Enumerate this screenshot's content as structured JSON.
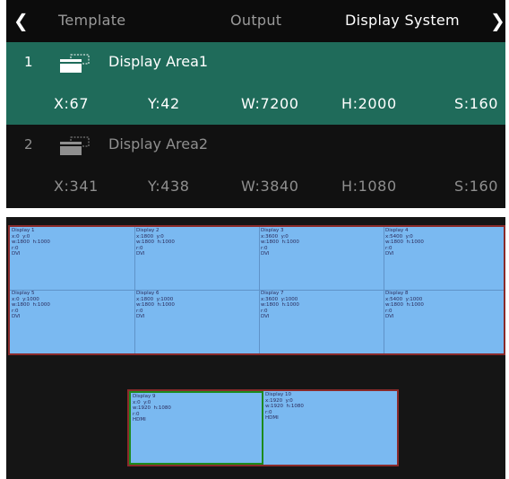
{
  "tabs": {
    "back_icon": "chevron-left-icon",
    "items": [
      "Template",
      "Output",
      "Display System"
    ],
    "active": "Display System",
    "forward_icon": "chevron-right-icon"
  },
  "areas": [
    {
      "num": "1",
      "label": "Display Area1",
      "x": "X:67",
      "y": "Y:42",
      "w": "W:7200",
      "h": "H:2000",
      "s": "S:160",
      "selected": true
    },
    {
      "num": "2",
      "label": "Display Area2",
      "x": "X:341",
      "y": "Y:438",
      "w": "W:3840",
      "h": "H:1080",
      "s": "S:160",
      "selected": false
    }
  ],
  "displays": [
    {
      "title": "Display 1",
      "pos": "x:0  y:0",
      "size": "w:1800  h:1000",
      "r": "r:0",
      "port": "DVI"
    },
    {
      "title": "Display 2",
      "pos": "x:1800  y:0",
      "size": "w:1800  h:1000",
      "r": "r:0",
      "port": "DVI"
    },
    {
      "title": "Display 3",
      "pos": "x:3600  y:0",
      "size": "w:1800  h:1000",
      "r": "r:0",
      "port": "DVI"
    },
    {
      "title": "Display 4",
      "pos": "x:5400  y:0",
      "size": "w:1800  h:1000",
      "r": "r:0",
      "port": "DVI"
    },
    {
      "title": "Display 5",
      "pos": "x:0  y:1000",
      "size": "w:1800  h:1000",
      "r": "r:0",
      "port": "DVI"
    },
    {
      "title": "Display 6",
      "pos": "x:1800  y:1000",
      "size": "w:1800  h:1000",
      "r": "r:0",
      "port": "DVI"
    },
    {
      "title": "Display 7",
      "pos": "x:3600  y:1000",
      "size": "w:1800  h:1000",
      "r": "r:0",
      "port": "DVI"
    },
    {
      "title": "Display 8",
      "pos": "x:5400  y:1000",
      "size": "w:1800  h:1000",
      "r": "r:0",
      "port": "DVI"
    },
    {
      "title": "Display 9",
      "pos": "x:0  y:0",
      "size": "w:1920  h:1080",
      "r": "r:0",
      "port": "HDMI"
    },
    {
      "title": "Display 10",
      "pos": "x:1920  y:0",
      "size": "w:1920  h:1080",
      "r": "r:0",
      "port": "HDMI"
    }
  ],
  "colors": {
    "selected_row": "#1f6b5a",
    "display_fill": "#7ab9f1",
    "area_border": "#8a2a2a",
    "selected_display_border": "#1d8a1d"
  }
}
